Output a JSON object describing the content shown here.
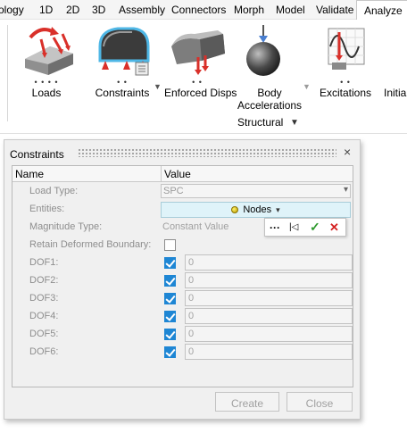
{
  "menubar": {
    "items": [
      "ology",
      "1D",
      "2D",
      "3D",
      "Assembly",
      "Connectors",
      "Morph",
      "Model",
      "Validate",
      "Analyze"
    ],
    "active": "Analyze"
  },
  "ribbon": {
    "tools": [
      {
        "label": "Loads",
        "icon": "loads-icon"
      },
      {
        "label": "Constraints",
        "icon": "constraints-icon"
      },
      {
        "label": "Enforced Disps",
        "icon": "enforced-disps-icon"
      },
      {
        "label1": "Body",
        "label2": "Accelerations",
        "icon": "body-accelerations-icon"
      },
      {
        "label": "Excitations",
        "icon": "excitations-icon"
      },
      {
        "label": "Initial",
        "icon": "initial-icon"
      }
    ],
    "dots": "• • • •",
    "dots_short": "• •",
    "group_label": "Structural"
  },
  "dialog": {
    "title": "Constraints",
    "close": "×",
    "columns": {
      "name": "Name",
      "value": "Value"
    },
    "rows": {
      "load_type": {
        "label": "Load Type:",
        "value": "SPC"
      },
      "entities": {
        "label": "Entities:",
        "value": "Nodes"
      },
      "magnitude_type": {
        "label": "Magnitude Type:",
        "value": "Constant Value"
      },
      "retain": {
        "label": "Retain Deformed Boundary:",
        "checked": false
      },
      "dofs": [
        {
          "label": "DOF1:",
          "value": "0",
          "checked": true
        },
        {
          "label": "DOF2:",
          "value": "0",
          "checked": true
        },
        {
          "label": "DOF3:",
          "value": "0",
          "checked": true
        },
        {
          "label": "DOF4:",
          "value": "0",
          "checked": true
        },
        {
          "label": "DOF5:",
          "value": "0",
          "checked": true
        },
        {
          "label": "DOF6:",
          "value": "0",
          "checked": true
        }
      ]
    },
    "mini_toolbar": {
      "more": "···",
      "reset": "|◁",
      "accept": "✓",
      "reject": "✕"
    },
    "buttons": {
      "create": "Create",
      "close": "Close"
    }
  },
  "colors": {
    "accent": "#1e86d4",
    "entity_bg": "#dff3f9",
    "accept": "#2e9a2e",
    "reject": "#d42020",
    "icon_red": "#d9302a"
  }
}
